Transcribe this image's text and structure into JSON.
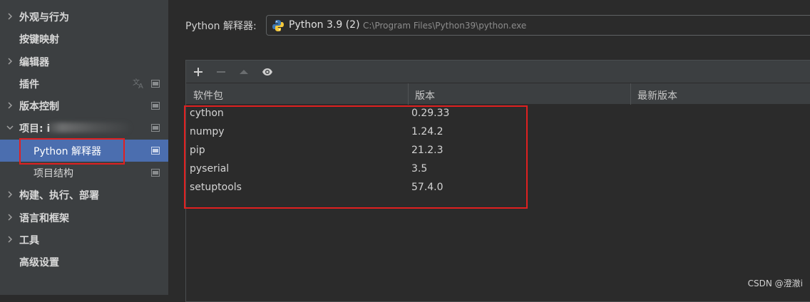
{
  "sidebar": {
    "items": [
      {
        "label": "外观与行为",
        "chevron": "right"
      },
      {
        "label": "按键映射"
      },
      {
        "label": "编辑器",
        "chevron": "right"
      },
      {
        "label": "插件"
      },
      {
        "label": "版本控制",
        "chevron": "right"
      },
      {
        "label": "项目: i",
        "chevron": "down"
      },
      {
        "label": "Python 解释器"
      },
      {
        "label": "项目结构"
      },
      {
        "label": "构建、执行、部署",
        "chevron": "right"
      },
      {
        "label": "语言和框架",
        "chevron": "right"
      },
      {
        "label": "工具",
        "chevron": "right"
      },
      {
        "label": "高级设置"
      }
    ],
    "selected": "Python 解释器"
  },
  "interpreter": {
    "label": "Python 解释器:",
    "name": "Python 3.9 (2)",
    "path": "C:\\Program Files\\Python39\\python.exe"
  },
  "toolbar": {
    "icons": [
      "plus-icon",
      "minus-icon",
      "up-arrow-icon",
      "eye-icon"
    ]
  },
  "table": {
    "columns": [
      "软件包",
      "版本",
      "最新版本"
    ],
    "rows": [
      {
        "package": "cython",
        "version": "0.29.33",
        "latest": ""
      },
      {
        "package": "numpy",
        "version": "1.24.2",
        "latest": ""
      },
      {
        "package": "pip",
        "version": "21.2.3",
        "latest": ""
      },
      {
        "package": "pyserial",
        "version": "3.5",
        "latest": ""
      },
      {
        "package": "setuptools",
        "version": "57.4.0",
        "latest": ""
      }
    ]
  },
  "watermark": "CSDN @澄澈i",
  "colors": {
    "background": "#2b2b2b",
    "sidebar": "#3c3f41",
    "selection": "#4b6eaf",
    "highlight_box": "#e02020"
  }
}
